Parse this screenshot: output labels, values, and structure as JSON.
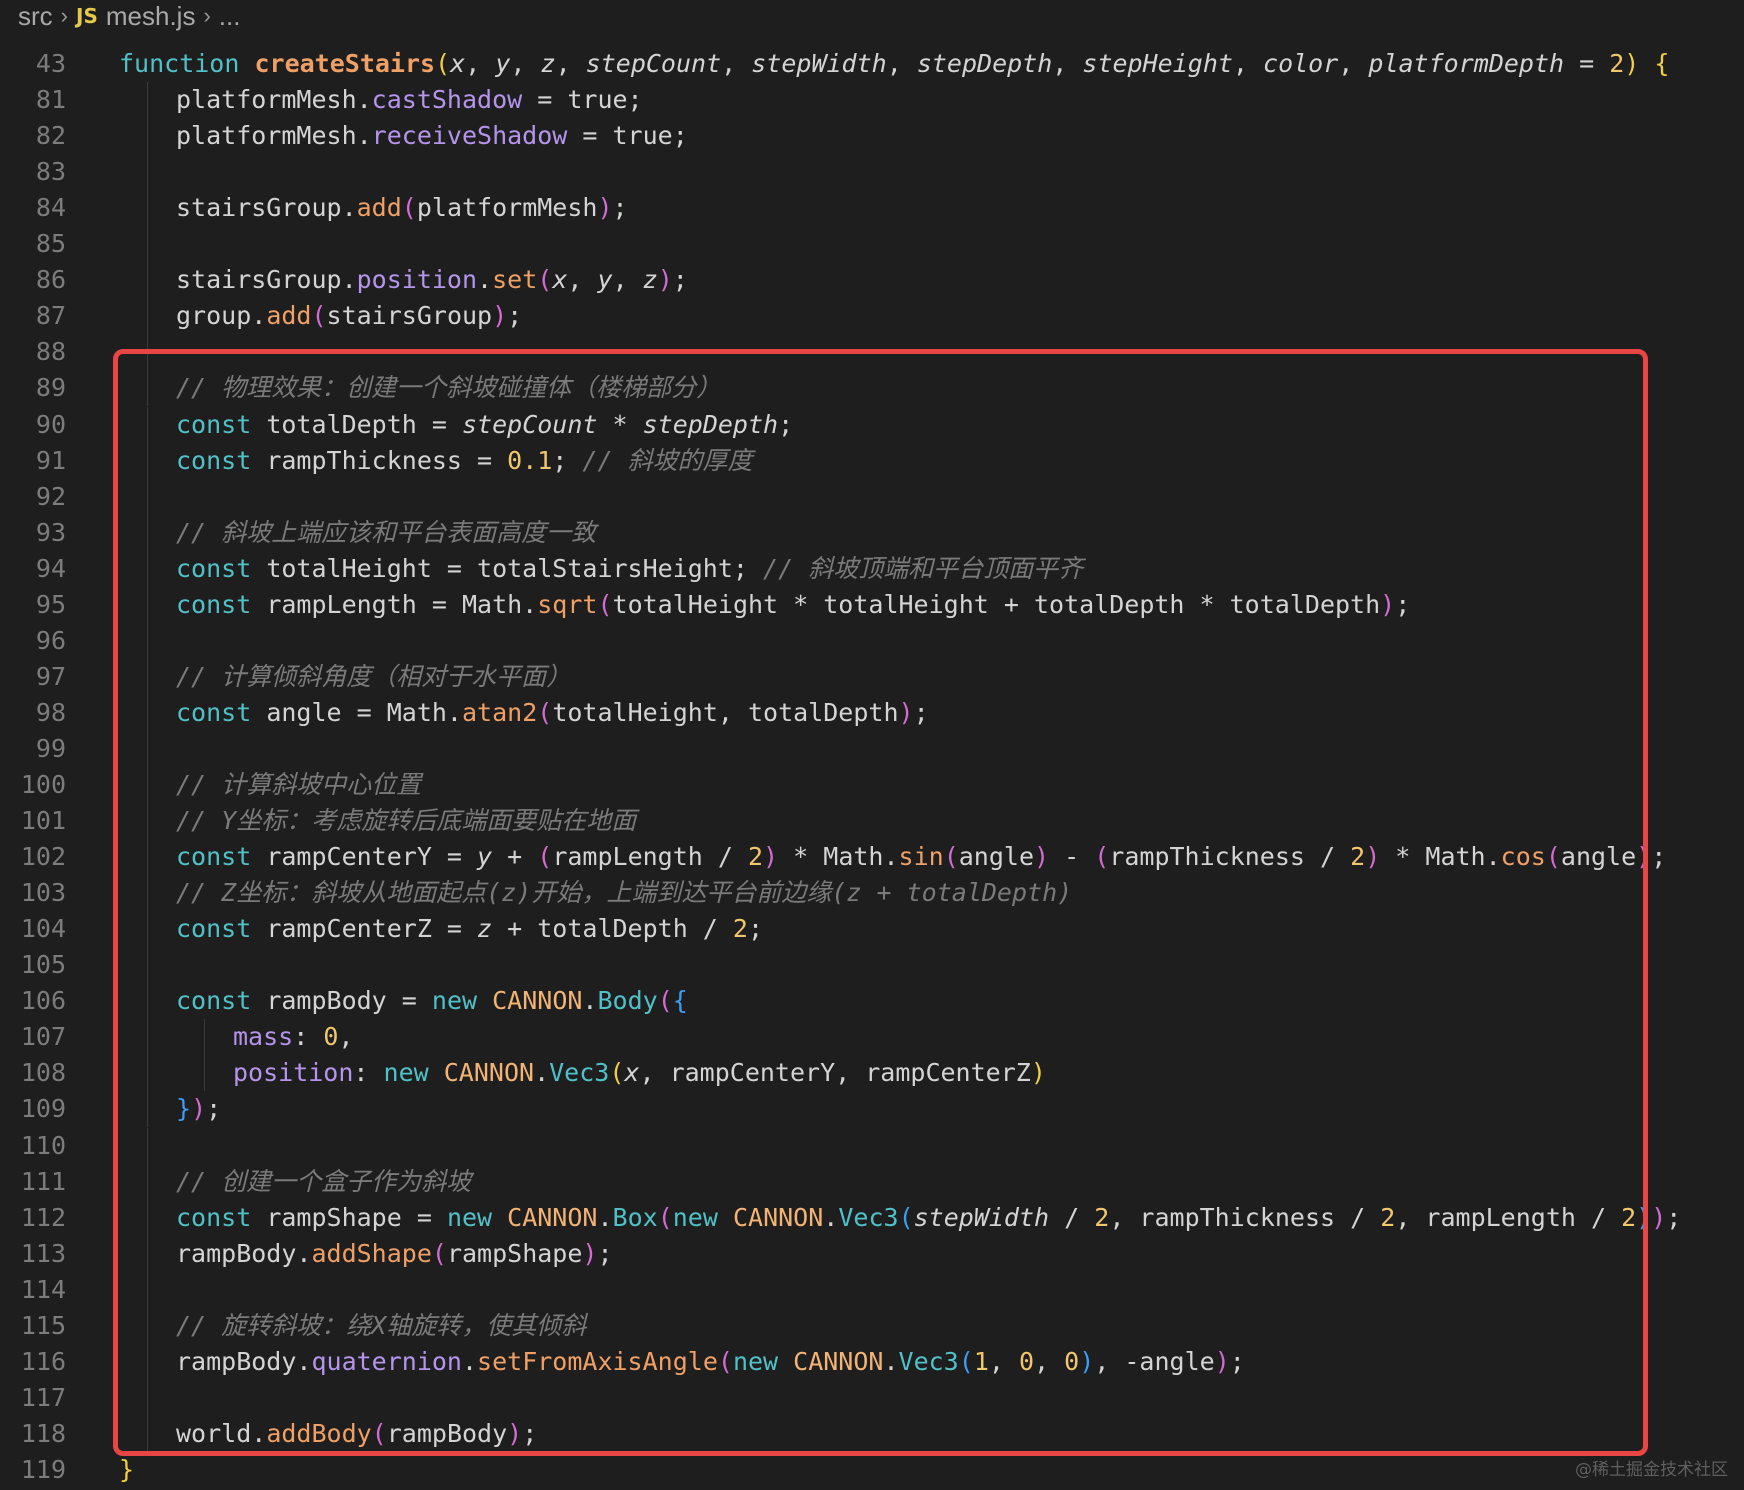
{
  "breadcrumb": {
    "folder": "src",
    "file_badge": "JS",
    "file": "mesh.js",
    "trail": "..."
  },
  "highlight": {
    "color": "#e84545"
  },
  "watermark": "@稀土掘金技术社区",
  "lines": [
    {
      "n": "43",
      "indent": 0,
      "tokens": [
        {
          "t": "function ",
          "c": "kw"
        },
        {
          "t": "createStairs",
          "c": "fnb"
        },
        {
          "t": "(",
          "c": "p1"
        },
        {
          "t": "x",
          "c": "it"
        },
        {
          "t": ", "
        },
        {
          "t": "y",
          "c": "it"
        },
        {
          "t": ", "
        },
        {
          "t": "z",
          "c": "it"
        },
        {
          "t": ", "
        },
        {
          "t": "stepCount",
          "c": "it"
        },
        {
          "t": ", "
        },
        {
          "t": "stepWidth",
          "c": "it"
        },
        {
          "t": ", "
        },
        {
          "t": "stepDepth",
          "c": "it"
        },
        {
          "t": ", "
        },
        {
          "t": "stepHeight",
          "c": "it"
        },
        {
          "t": ", "
        },
        {
          "t": "color",
          "c": "it"
        },
        {
          "t": ", "
        },
        {
          "t": "platformDepth",
          "c": "it"
        },
        {
          "t": " = "
        },
        {
          "t": "2",
          "c": "num"
        },
        {
          "t": ")",
          "c": "p1"
        },
        {
          "t": " "
        },
        {
          "t": "{",
          "c": "p1"
        }
      ]
    },
    {
      "n": "81",
      "indent": 1,
      "tokens": [
        {
          "t": "platformMesh."
        },
        {
          "t": "castShadow",
          "c": "prop"
        },
        {
          "t": " = true;"
        }
      ]
    },
    {
      "n": "82",
      "indent": 1,
      "tokens": [
        {
          "t": "platformMesh."
        },
        {
          "t": "receiveShadow",
          "c": "prop"
        },
        {
          "t": " = true;"
        }
      ]
    },
    {
      "n": "83",
      "indent": 1,
      "tokens": []
    },
    {
      "n": "84",
      "indent": 1,
      "tokens": [
        {
          "t": "stairsGroup."
        },
        {
          "t": "add",
          "c": "fn"
        },
        {
          "t": "(",
          "c": "p2"
        },
        {
          "t": "platformMesh"
        },
        {
          "t": ")",
          "c": "p2"
        },
        {
          "t": ";"
        }
      ]
    },
    {
      "n": "85",
      "indent": 1,
      "tokens": []
    },
    {
      "n": "86",
      "indent": 1,
      "tokens": [
        {
          "t": "stairsGroup."
        },
        {
          "t": "position",
          "c": "prop"
        },
        {
          "t": "."
        },
        {
          "t": "set",
          "c": "fn"
        },
        {
          "t": "(",
          "c": "p2"
        },
        {
          "t": "x",
          "c": "it"
        },
        {
          "t": ", "
        },
        {
          "t": "y",
          "c": "it"
        },
        {
          "t": ", "
        },
        {
          "t": "z",
          "c": "it"
        },
        {
          "t": ")",
          "c": "p2"
        },
        {
          "t": ";"
        }
      ]
    },
    {
      "n": "87",
      "indent": 1,
      "tokens": [
        {
          "t": "group."
        },
        {
          "t": "add",
          "c": "fn"
        },
        {
          "t": "(",
          "c": "p2"
        },
        {
          "t": "stairsGroup"
        },
        {
          "t": ")",
          "c": "p2"
        },
        {
          "t": ";"
        }
      ]
    },
    {
      "n": "88",
      "indent": 1,
      "tokens": []
    },
    {
      "n": "89",
      "indent": 1,
      "tokens": [
        {
          "t": "// 物理效果：创建一个斜坡碰撞体（楼梯部分）",
          "c": "cmt"
        }
      ]
    },
    {
      "n": "90",
      "indent": 1,
      "tokens": [
        {
          "t": "const ",
          "c": "kw"
        },
        {
          "t": "totalDepth = "
        },
        {
          "t": "stepCount",
          "c": "it"
        },
        {
          "t": " * "
        },
        {
          "t": "stepDepth",
          "c": "it"
        },
        {
          "t": ";"
        }
      ]
    },
    {
      "n": "91",
      "indent": 1,
      "tokens": [
        {
          "t": "const ",
          "c": "kw"
        },
        {
          "t": "rampThickness = "
        },
        {
          "t": "0.1",
          "c": "num"
        },
        {
          "t": "; "
        },
        {
          "t": "// 斜坡的厚度",
          "c": "cmt"
        }
      ]
    },
    {
      "n": "92",
      "indent": 1,
      "tokens": []
    },
    {
      "n": "93",
      "indent": 1,
      "tokens": [
        {
          "t": "// 斜坡上端应该和平台表面高度一致",
          "c": "cmt"
        }
      ]
    },
    {
      "n": "94",
      "indent": 1,
      "tokens": [
        {
          "t": "const ",
          "c": "kw"
        },
        {
          "t": "totalHeight = totalStairsHeight; "
        },
        {
          "t": "// 斜坡顶端和平台顶面平齐",
          "c": "cmt"
        }
      ]
    },
    {
      "n": "95",
      "indent": 1,
      "tokens": [
        {
          "t": "const ",
          "c": "kw"
        },
        {
          "t": "rampLength = Math."
        },
        {
          "t": "sqrt",
          "c": "fn"
        },
        {
          "t": "(",
          "c": "p2"
        },
        {
          "t": "totalHeight * totalHeight + totalDepth * totalDepth"
        },
        {
          "t": ")",
          "c": "p2"
        },
        {
          "t": ";"
        }
      ]
    },
    {
      "n": "96",
      "indent": 1,
      "tokens": []
    },
    {
      "n": "97",
      "indent": 1,
      "tokens": [
        {
          "t": "// 计算倾斜角度（相对于水平面）",
          "c": "cmt"
        }
      ]
    },
    {
      "n": "98",
      "indent": 1,
      "tokens": [
        {
          "t": "const ",
          "c": "kw"
        },
        {
          "t": "angle = Math."
        },
        {
          "t": "atan2",
          "c": "fn"
        },
        {
          "t": "(",
          "c": "p2"
        },
        {
          "t": "totalHeight, totalDepth"
        },
        {
          "t": ")",
          "c": "p2"
        },
        {
          "t": ";"
        }
      ]
    },
    {
      "n": "99",
      "indent": 1,
      "tokens": []
    },
    {
      "n": "100",
      "indent": 1,
      "tokens": [
        {
          "t": "// 计算斜坡中心位置",
          "c": "cmt"
        }
      ]
    },
    {
      "n": "101",
      "indent": 1,
      "tokens": [
        {
          "t": "// Y坐标：考虑旋转后底端面要贴在地面",
          "c": "cmt"
        }
      ]
    },
    {
      "n": "102",
      "indent": 1,
      "tokens": [
        {
          "t": "const ",
          "c": "kw"
        },
        {
          "t": "rampCenterY = "
        },
        {
          "t": "y",
          "c": "it"
        },
        {
          "t": " + "
        },
        {
          "t": "(",
          "c": "p2"
        },
        {
          "t": "rampLength / "
        },
        {
          "t": "2",
          "c": "num"
        },
        {
          "t": ")",
          "c": "p2"
        },
        {
          "t": " * Math."
        },
        {
          "t": "sin",
          "c": "fn"
        },
        {
          "t": "(",
          "c": "p2"
        },
        {
          "t": "angle"
        },
        {
          "t": ")",
          "c": "p2"
        },
        {
          "t": " - "
        },
        {
          "t": "(",
          "c": "p2"
        },
        {
          "t": "rampThickness / "
        },
        {
          "t": "2",
          "c": "num"
        },
        {
          "t": ")",
          "c": "p2"
        },
        {
          "t": " * Math."
        },
        {
          "t": "cos",
          "c": "fn"
        },
        {
          "t": "(",
          "c": "p2"
        },
        {
          "t": "angle"
        },
        {
          "t": ")",
          "c": "p2"
        },
        {
          "t": ";"
        }
      ]
    },
    {
      "n": "103",
      "indent": 1,
      "tokens": [
        {
          "t": "// Z坐标：斜坡从地面起点(z)开始，上端到达平台前边缘(z + totalDepth)",
          "c": "cmt"
        }
      ]
    },
    {
      "n": "104",
      "indent": 1,
      "tokens": [
        {
          "t": "const ",
          "c": "kw"
        },
        {
          "t": "rampCenterZ = "
        },
        {
          "t": "z",
          "c": "it"
        },
        {
          "t": " + totalDepth / "
        },
        {
          "t": "2",
          "c": "num"
        },
        {
          "t": ";"
        }
      ]
    },
    {
      "n": "105",
      "indent": 1,
      "tokens": []
    },
    {
      "n": "106",
      "indent": 1,
      "tokens": [
        {
          "t": "const ",
          "c": "kw"
        },
        {
          "t": "rampBody = "
        },
        {
          "t": "new ",
          "c": "kw"
        },
        {
          "t": "CANNON",
          "c": "cls"
        },
        {
          "t": "."
        },
        {
          "t": "Body",
          "c": "kw"
        },
        {
          "t": "(",
          "c": "p2"
        },
        {
          "t": "{",
          "c": "p3"
        }
      ]
    },
    {
      "n": "107",
      "indent": 2,
      "tokens": [
        {
          "t": "mass",
          "c": "prop"
        },
        {
          "t": ": "
        },
        {
          "t": "0",
          "c": "num"
        },
        {
          "t": ","
        }
      ]
    },
    {
      "n": "108",
      "indent": 2,
      "tokens": [
        {
          "t": "position",
          "c": "prop"
        },
        {
          "t": ": "
        },
        {
          "t": "new ",
          "c": "kw"
        },
        {
          "t": "CANNON",
          "c": "cls"
        },
        {
          "t": "."
        },
        {
          "t": "Vec3",
          "c": "kw"
        },
        {
          "t": "(",
          "c": "p1"
        },
        {
          "t": "x",
          "c": "it"
        },
        {
          "t": ", rampCenterY, rampCenterZ"
        },
        {
          "t": ")",
          "c": "p1"
        }
      ]
    },
    {
      "n": "109",
      "indent": 1,
      "tokens": [
        {
          "t": "}",
          "c": "p3"
        },
        {
          "t": ")",
          "c": "p2"
        },
        {
          "t": ";"
        }
      ]
    },
    {
      "n": "110",
      "indent": 1,
      "tokens": []
    },
    {
      "n": "111",
      "indent": 1,
      "tokens": [
        {
          "t": "// 创建一个盒子作为斜坡",
          "c": "cmt"
        }
      ]
    },
    {
      "n": "112",
      "indent": 1,
      "tokens": [
        {
          "t": "const ",
          "c": "kw"
        },
        {
          "t": "rampShape = "
        },
        {
          "t": "new ",
          "c": "kw"
        },
        {
          "t": "CANNON",
          "c": "cls"
        },
        {
          "t": "."
        },
        {
          "t": "Box",
          "c": "kw"
        },
        {
          "t": "(",
          "c": "p2"
        },
        {
          "t": "new ",
          "c": "kw"
        },
        {
          "t": "CANNON",
          "c": "cls"
        },
        {
          "t": "."
        },
        {
          "t": "Vec3",
          "c": "kw"
        },
        {
          "t": "(",
          "c": "p3"
        },
        {
          "t": "stepWidth",
          "c": "it"
        },
        {
          "t": " / "
        },
        {
          "t": "2",
          "c": "num"
        },
        {
          "t": ", rampThickness / "
        },
        {
          "t": "2",
          "c": "num"
        },
        {
          "t": ", rampLength / "
        },
        {
          "t": "2",
          "c": "num"
        },
        {
          "t": ")",
          "c": "p3"
        },
        {
          "t": ")",
          "c": "p2"
        },
        {
          "t": ";"
        }
      ]
    },
    {
      "n": "113",
      "indent": 1,
      "tokens": [
        {
          "t": "rampBody."
        },
        {
          "t": "addShape",
          "c": "fn"
        },
        {
          "t": "(",
          "c": "p2"
        },
        {
          "t": "rampShape"
        },
        {
          "t": ")",
          "c": "p2"
        },
        {
          "t": ";"
        }
      ]
    },
    {
      "n": "114",
      "indent": 1,
      "tokens": []
    },
    {
      "n": "115",
      "indent": 1,
      "tokens": [
        {
          "t": "// 旋转斜坡：绕X轴旋转，使其倾斜",
          "c": "cmt"
        }
      ]
    },
    {
      "n": "116",
      "indent": 1,
      "tokens": [
        {
          "t": "rampBody."
        },
        {
          "t": "quaternion",
          "c": "prop"
        },
        {
          "t": "."
        },
        {
          "t": "setFromAxisAngle",
          "c": "fn"
        },
        {
          "t": "(",
          "c": "p2"
        },
        {
          "t": "new ",
          "c": "kw"
        },
        {
          "t": "CANNON",
          "c": "cls"
        },
        {
          "t": "."
        },
        {
          "t": "Vec3",
          "c": "kw"
        },
        {
          "t": "(",
          "c": "p3"
        },
        {
          "t": "1",
          "c": "num"
        },
        {
          "t": ", "
        },
        {
          "t": "0",
          "c": "num"
        },
        {
          "t": ", "
        },
        {
          "t": "0",
          "c": "num"
        },
        {
          "t": ")",
          "c": "p3"
        },
        {
          "t": ", -angle"
        },
        {
          "t": ")",
          "c": "p2"
        },
        {
          "t": ";"
        }
      ]
    },
    {
      "n": "117",
      "indent": 1,
      "tokens": []
    },
    {
      "n": "118",
      "indent": 1,
      "tokens": [
        {
          "t": "world."
        },
        {
          "t": "addBody",
          "c": "fn"
        },
        {
          "t": "(",
          "c": "p2"
        },
        {
          "t": "rampBody"
        },
        {
          "t": ")",
          "c": "p2"
        },
        {
          "t": ";"
        }
      ]
    },
    {
      "n": "119",
      "indent": 0,
      "tokens": [
        {
          "t": "}",
          "c": "p1"
        }
      ]
    }
  ]
}
